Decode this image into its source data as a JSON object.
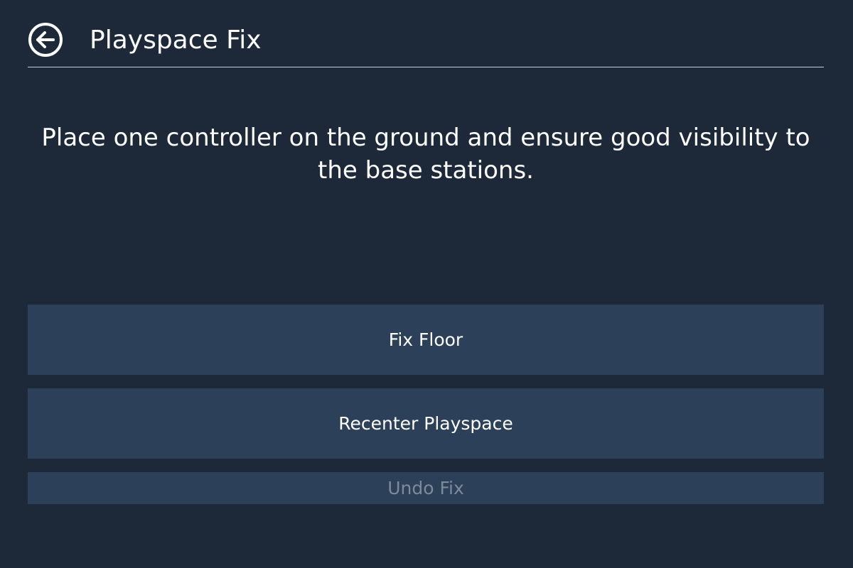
{
  "header": {
    "back_icon": "arrow-left-circle-icon",
    "title": "Playspace Fix"
  },
  "instruction": {
    "text": "Place one controller on the ground and ensure good visibility to the base stations."
  },
  "actions": {
    "fix_floor_label": "Fix Floor",
    "recenter_label": "Recenter Playspace",
    "undo_label": "Undo Fix",
    "undo_disabled": true
  },
  "colors": {
    "background": "#1d2939",
    "button": "#2c405a",
    "text": "#ffffff",
    "disabled_text": "#7f8a97",
    "divider": "#c9ced6"
  }
}
